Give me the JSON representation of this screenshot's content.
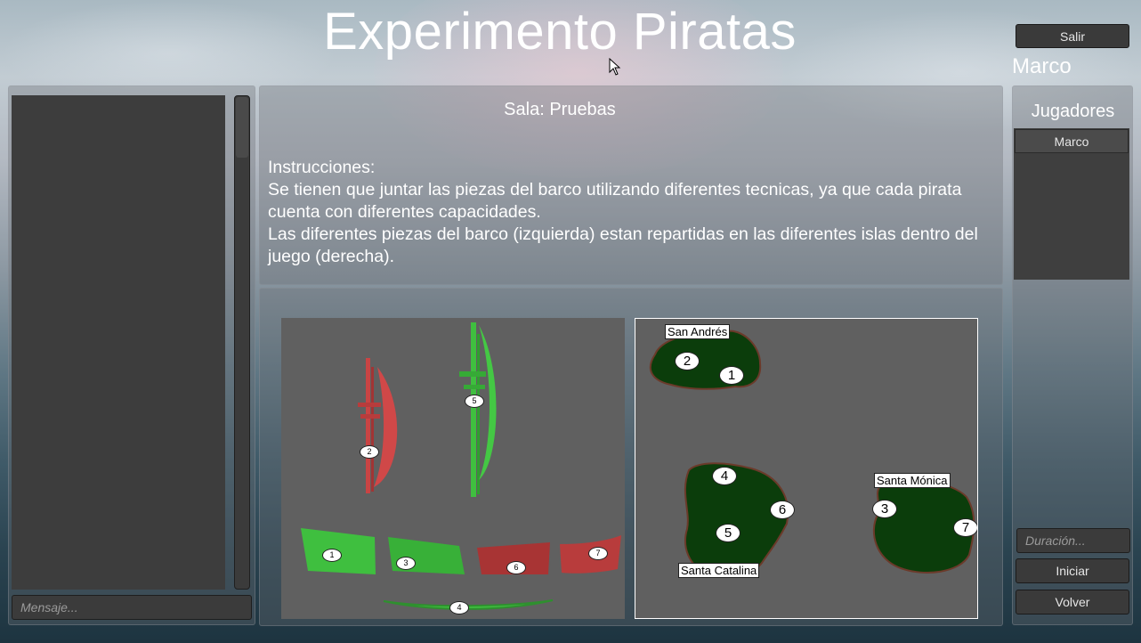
{
  "window": {
    "title": "Experimento Piratas"
  },
  "header": {
    "exit_label": "Salir",
    "username": "Marco"
  },
  "chat": {
    "message_placeholder": "Mensaje..."
  },
  "room": {
    "label": "Sala: Pruebas",
    "instructions": {
      "heading": "Instrucciones:",
      "line1": "Se tienen que juntar las piezas del barco utilizando diferentes tecnicas, ya que cada pirata cuenta con diferentes capacidades.",
      "line2": "Las diferentes piezas del barco (izquierda) estan repartidas en las diferentes islas dentro del juego (derecha)."
    }
  },
  "ship_pieces": {
    "labels": [
      "1",
      "2",
      "3",
      "4",
      "5",
      "6",
      "7"
    ],
    "colors": {
      "green": "#3fbf3f",
      "red": "#c94444"
    }
  },
  "map": {
    "islands": [
      "San Andrés",
      "Santa Catalina",
      "Santa Mónica"
    ],
    "markers": [
      "1",
      "2",
      "3",
      "4",
      "5",
      "6",
      "7"
    ],
    "island_color": "#0b3d0b"
  },
  "players": {
    "title": "Jugadores",
    "list": [
      "Marco"
    ]
  },
  "controls": {
    "duration_placeholder": "Duración...",
    "start_label": "Iniciar",
    "back_label": "Volver"
  }
}
